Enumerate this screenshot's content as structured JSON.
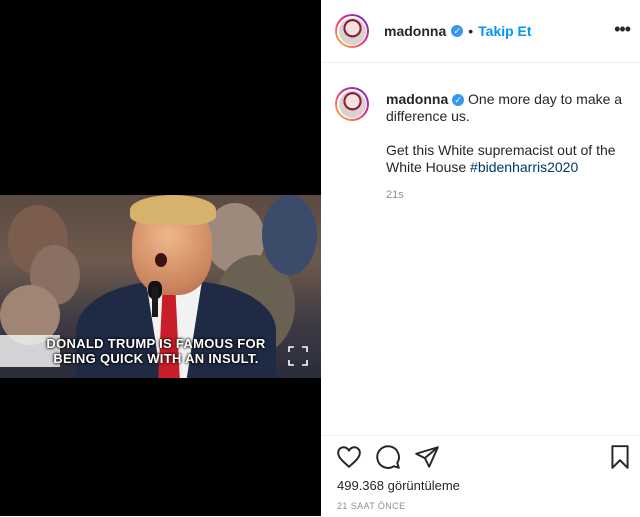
{
  "post": {
    "username": "madonna",
    "verified_mark": "✓",
    "follow_label": "Takip Et",
    "more_label": "•••",
    "caption_line1": "One more day to make a difference us.",
    "caption_line2_text": "Get this White supremacist out of the White House ",
    "hashtag": "#bidenharris2020",
    "comment_time": "21s",
    "views": "499.368 görüntüleme",
    "posted_ago": "21 SAAT ÖNCE"
  },
  "video": {
    "caption_line1": "DONALD TRUMP IS FAMOUS FOR",
    "caption_line2": "BEING QUICK WITH AN INSULT."
  },
  "icons": {
    "like": "heart-icon",
    "comment": "comment-icon",
    "share": "paper-plane-icon",
    "save": "bookmark-icon",
    "expand": "expand-icon",
    "more": "more-options-icon"
  },
  "colors": {
    "accent": "#0095f6",
    "verified": "#3897f0",
    "hashtag": "#00376b",
    "muted": "#8e8e8e",
    "tie": "#c81e2a"
  }
}
